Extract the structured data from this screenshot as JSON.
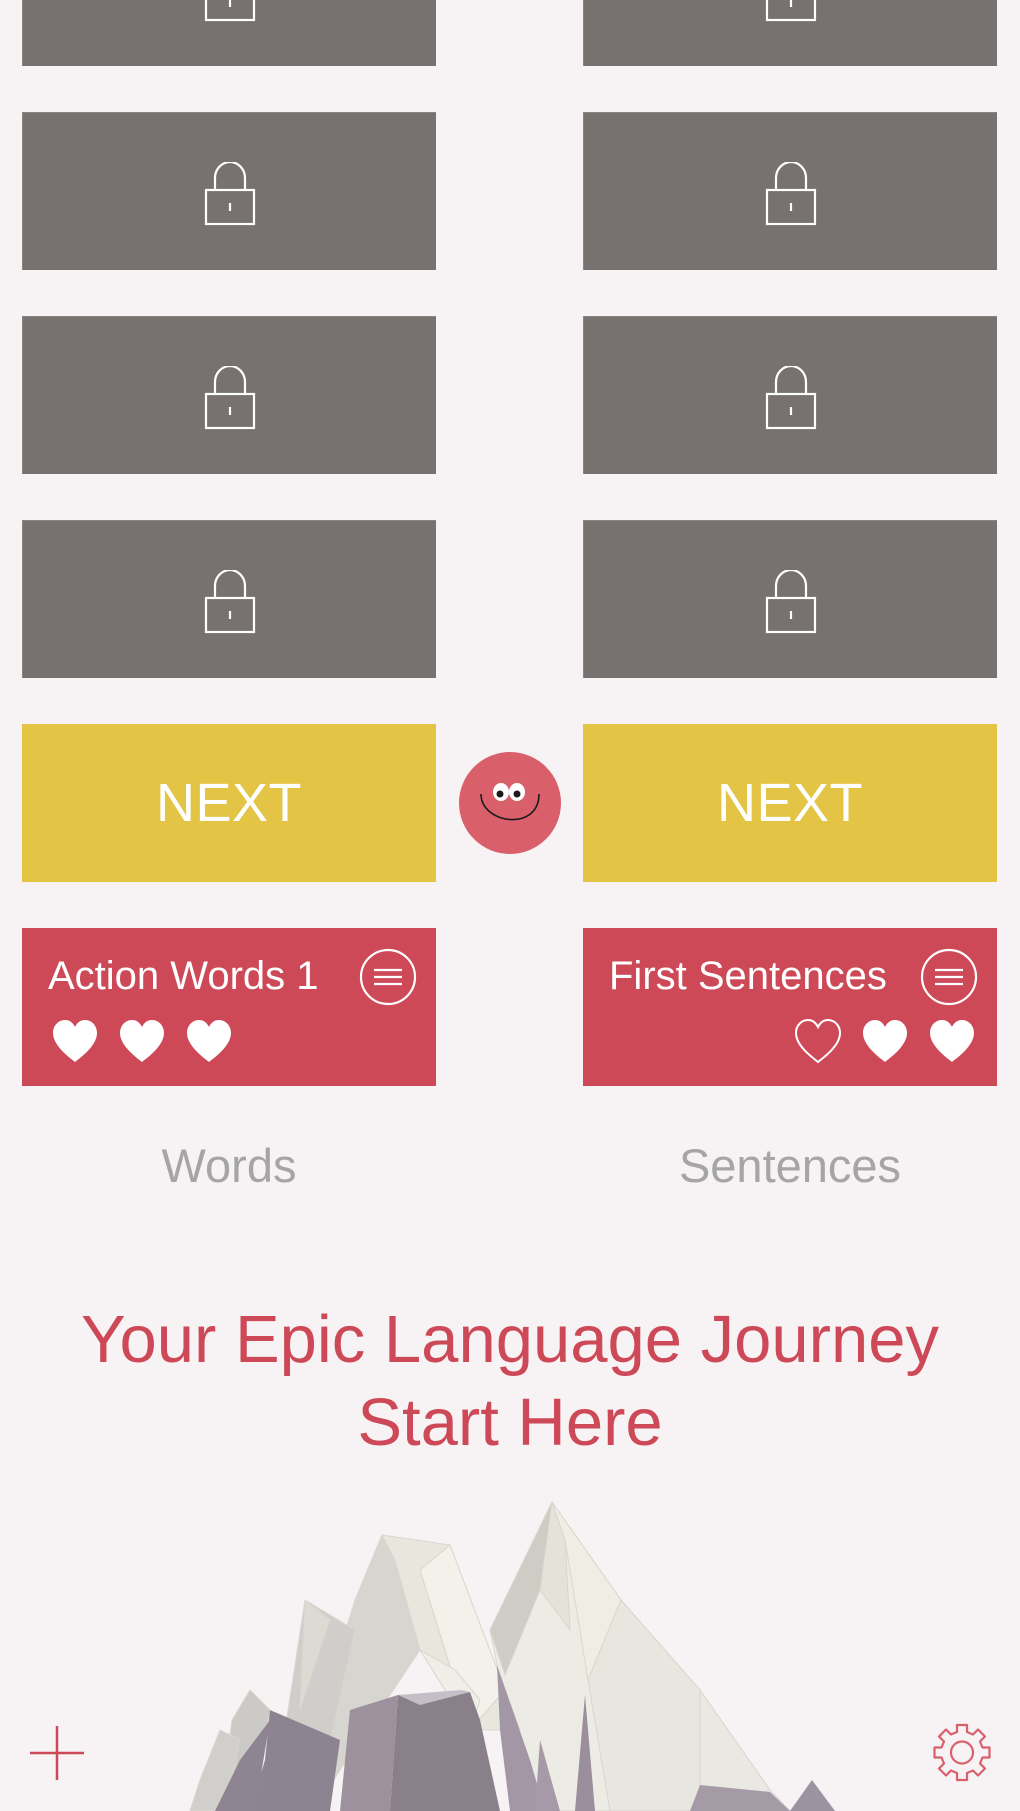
{
  "colors": {
    "background": "#f7f3f5",
    "locked": "#777170",
    "next": "#e3c445",
    "card": "#cd4957",
    "accent": "#cd4957",
    "label": "#a5a5a5",
    "mascot": "#d9606b"
  },
  "columns": [
    {
      "id": "words",
      "label": "Words",
      "locked_tiles": 4,
      "next_label": "NEXT",
      "current_lesson": {
        "title": "Action Words 1",
        "menu_icon": "menu-icon",
        "hearts": [
          {
            "state": "filled"
          },
          {
            "state": "filled"
          },
          {
            "state": "filled"
          }
        ]
      }
    },
    {
      "id": "sentences",
      "label": "Sentences",
      "locked_tiles": 4,
      "next_label": "NEXT",
      "current_lesson": {
        "title": "First Sentences",
        "menu_icon": "menu-icon",
        "hearts": [
          {
            "state": "empty"
          },
          {
            "state": "filled"
          },
          {
            "state": "filled"
          }
        ]
      }
    }
  ],
  "mascot": {
    "icon": "smiley-face-icon"
  },
  "headline": {
    "line1": "Your Epic Language Journey",
    "line2": "Start Here"
  },
  "footer": {
    "add_icon": "plus-icon",
    "settings_icon": "gear-icon"
  }
}
